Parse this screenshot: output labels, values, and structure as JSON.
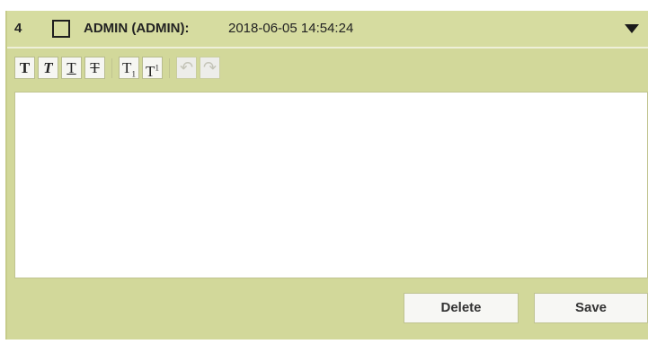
{
  "comment": {
    "index": "4",
    "author": "ADMIN (ADMIN):",
    "timestamp": "2018-06-05 14:54:24",
    "editor_value": ""
  },
  "toolbar": {
    "bold": "T",
    "italic": "T",
    "underline": "T",
    "strikethrough": "T",
    "subscript_base": "T",
    "subscript_mark": "1",
    "superscript_base": "T",
    "superscript_mark": "1",
    "undo": "↶",
    "redo": "↷"
  },
  "actions": {
    "delete_label": "Delete",
    "save_label": "Save"
  },
  "colors": {
    "panel_background": "#d2d89a",
    "button_background": "#f7f7f4",
    "editor_background": "#ffffff"
  }
}
